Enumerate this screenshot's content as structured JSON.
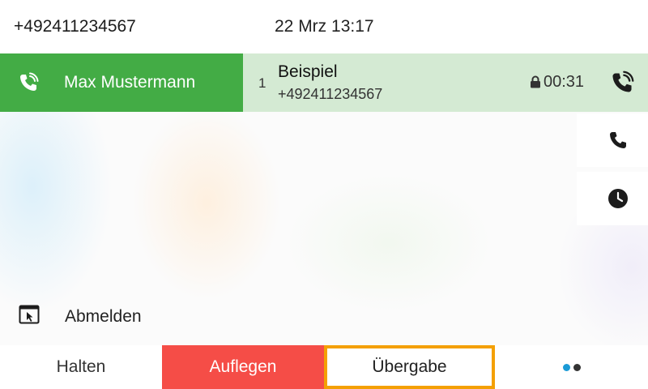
{
  "header": {
    "line_number": "+492411234567",
    "datetime": "22 Mrz 13:17"
  },
  "line_key": {
    "label": "Max Mustermann",
    "icon": "active-call-icon",
    "color": "#43ac45"
  },
  "call": {
    "index": "1",
    "name": "Beispiel",
    "number": "+492411234567",
    "duration": "00:31",
    "background": "#d4ead3"
  },
  "side_buttons": [
    {
      "icon": "phone-icon"
    },
    {
      "icon": "clock-icon"
    }
  ],
  "logout": {
    "label": "Abmelden",
    "icon": "logout-icon"
  },
  "softkeys": {
    "hold": "Halten",
    "end": "Auflegen",
    "transfer": "Übergabe",
    "end_color": "#f54d47",
    "focus_color": "#f4a004",
    "more_dots": [
      "#1a9ad6",
      "#333333"
    ]
  }
}
